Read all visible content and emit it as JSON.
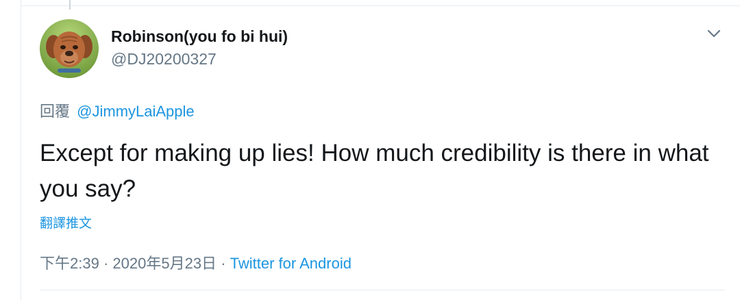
{
  "tweet": {
    "display_name": "Robinson(you fo bi hui)",
    "username": "@DJ20200327",
    "reply_label": "回覆",
    "reply_to": "@JimmyLaiApple",
    "text": "Except for making up lies! How much credibility is there in what you say?",
    "translate_label": "翻譯推文",
    "time": "下午2:39",
    "separator_1": "·",
    "date": "2020年5月23日",
    "separator_2": "·",
    "source": "Twitter for Android"
  },
  "icons": {
    "menu_caret": "chevron-down-icon",
    "avatar": "avatar-dog-photo"
  },
  "colors": {
    "link": "#1b95e0",
    "secondary_text": "#657786",
    "primary_text": "#14171a",
    "divider": "#e6ecf0"
  }
}
